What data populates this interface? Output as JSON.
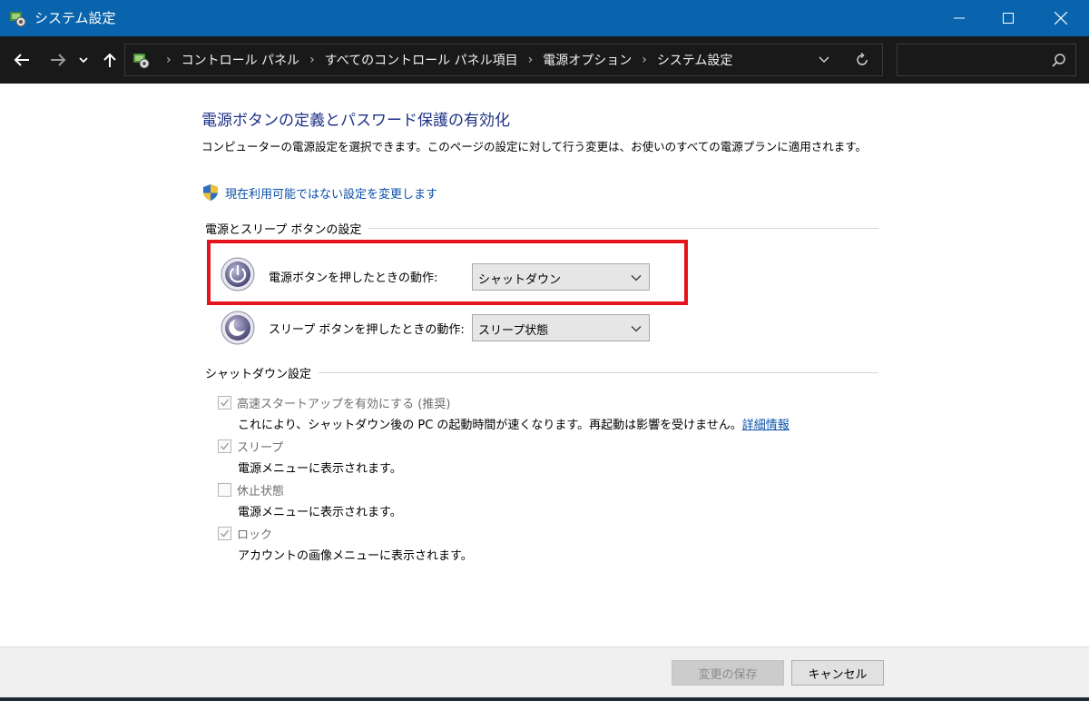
{
  "window": {
    "title": "システム設定"
  },
  "address": {
    "crumbs": [
      "コントロール パネル",
      "すべてのコントロール パネル項目",
      "電源オプション",
      "システム設定"
    ]
  },
  "search": {
    "placeholder": ""
  },
  "page": {
    "heading": "電源ボタンの定義とパスワード保護の有効化",
    "description": "コンピューターの電源設定を選択できます。このページの設定に対して行う変更は、お使いのすべての電源プランに適用されます。",
    "change_link": "現在利用可能ではない設定を変更します"
  },
  "power_buttons": {
    "group_label": "電源とスリープ ボタンの設定",
    "power": {
      "label": "電源ボタンを押したときの動作:",
      "value": "シャットダウン"
    },
    "sleep": {
      "label": "スリープ ボタンを押したときの動作:",
      "value": "スリープ状態"
    }
  },
  "shutdown": {
    "group_label": "シャットダウン設定",
    "items": [
      {
        "label": "高速スタートアップを有効にする (推奨)",
        "checked": true,
        "desc": "これにより、シャットダウン後の PC の起動時間が速くなります。再起動は影響を受けません。",
        "link": "詳細情報"
      },
      {
        "label": "スリープ",
        "checked": true,
        "desc": "電源メニューに表示されます。"
      },
      {
        "label": "休止状態",
        "checked": false,
        "desc": "電源メニューに表示されます。"
      },
      {
        "label": "ロック",
        "checked": true,
        "desc": "アカウントの画像メニューに表示されます。"
      }
    ]
  },
  "footer": {
    "save_label": "変更の保存",
    "cancel_label": "キャンセル"
  },
  "colors": {
    "titlebar": "#0a64ad",
    "navbar": "#191919",
    "heading": "#1e3287",
    "link": "#0a50a8",
    "highlight": "#e3141b"
  }
}
